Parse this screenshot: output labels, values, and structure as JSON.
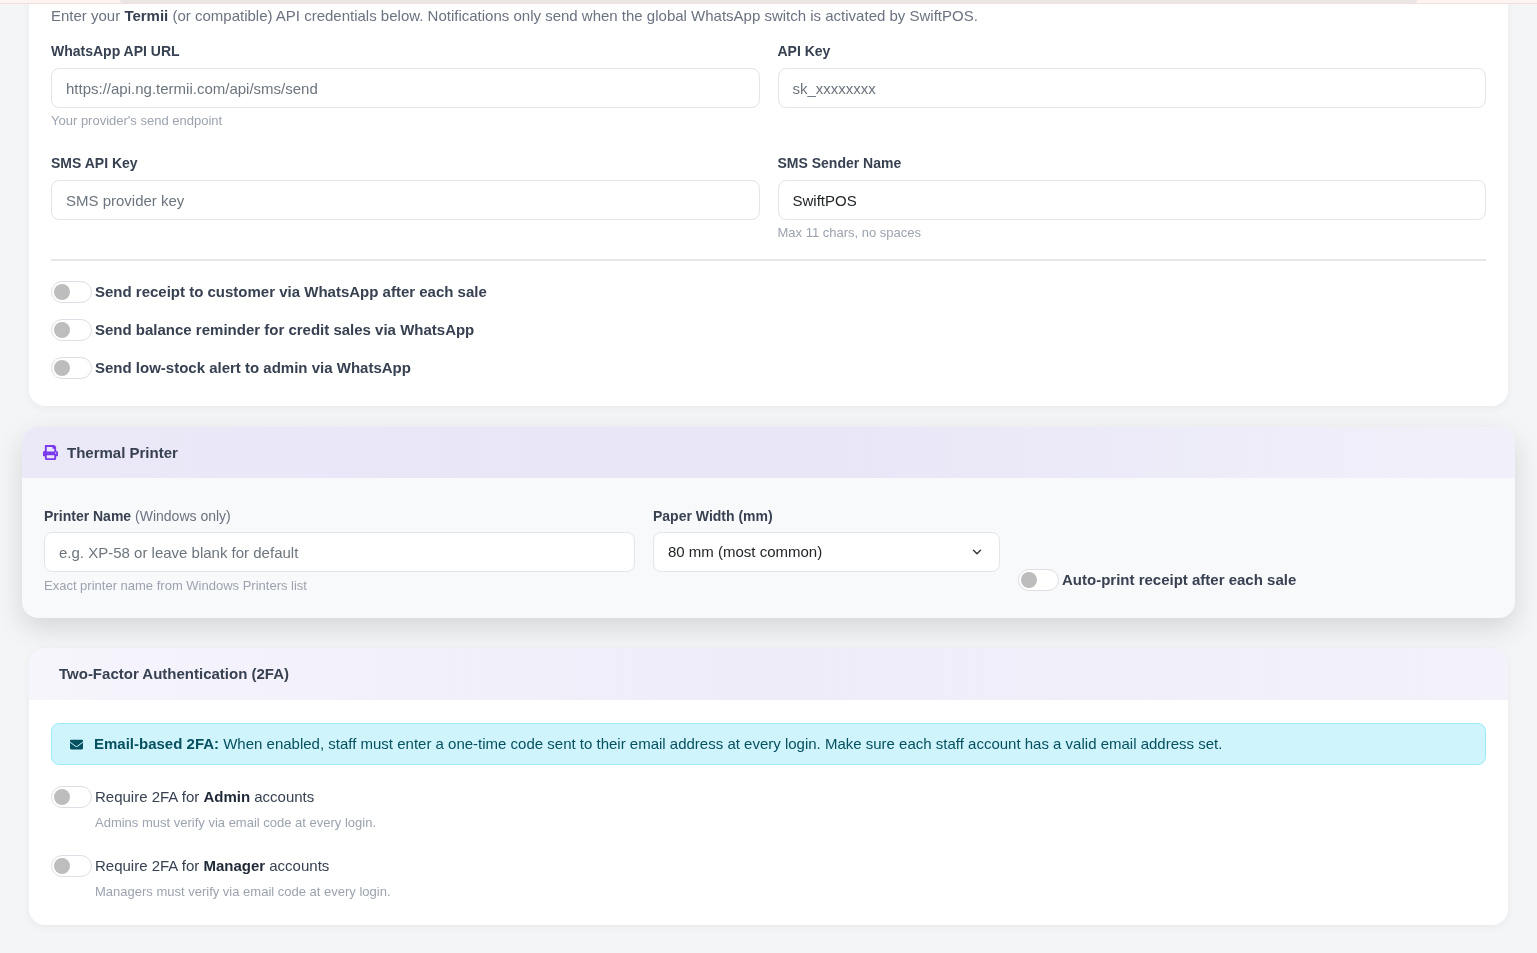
{
  "whatsapp_settings": {
    "description": "Enter your **Termii** (or compatible) API credentials below. Notifications only send when the global WhatsApp switch is activated by SwiftPOS.",
    "fields": [
      {
        "label": "WhatsApp API URL",
        "placeholder": "https://api.ng.termii.com/api/sms/send",
        "hint": "Your provider's send endpoint"
      },
      {
        "label": "API Key",
        "placeholder": "sk_xxxxxxxx"
      },
      {
        "label": "SMS API Key",
        "placeholder": "SMS provider key"
      },
      {
        "label": "SMS Sender Name",
        "value": "SwiftPOS",
        "hint": "Max 11 chars, no spaces"
      }
    ],
    "toggles": [
      {
        "label": "Send receipt to customer via WhatsApp after each sale",
        "on": false
      },
      {
        "label": "Send balance reminder for credit sales via WhatsApp",
        "on": false
      },
      {
        "label": "Send low-stock alert to admin via WhatsApp",
        "on": false
      }
    ]
  },
  "thermal_printer": {
    "title": "Thermal Printer",
    "fields": [
      {
        "kind": "text",
        "label": "**Printer Name** (Windows only)",
        "placeholder": "e.g. XP-58 or leave blank for default",
        "hint": "Exact printer name from Windows Printers list"
      },
      {
        "kind": "select",
        "label": "Paper Width (mm)",
        "value": "80 mm (most common)"
      },
      {
        "kind": "toggle",
        "label": "Auto-print receipt after each sale",
        "on": false
      }
    ]
  },
  "two_factor": {
    "title": "Two-Factor Authentication (2FA)",
    "notice": "**Email-based 2FA:** When enabled, staff must enter a one-time code sent to their email address at every login. Make sure each staff account has a valid email address set.",
    "toggles": [
      {
        "label": "Require 2FA for **Admin** accounts",
        "hint": "Admins must verify via email code at every login.",
        "on": false
      },
      {
        "label": "Require 2FA for **Manager** accounts",
        "hint": "Managers must verify via email code at every login.",
        "on": false
      }
    ]
  }
}
